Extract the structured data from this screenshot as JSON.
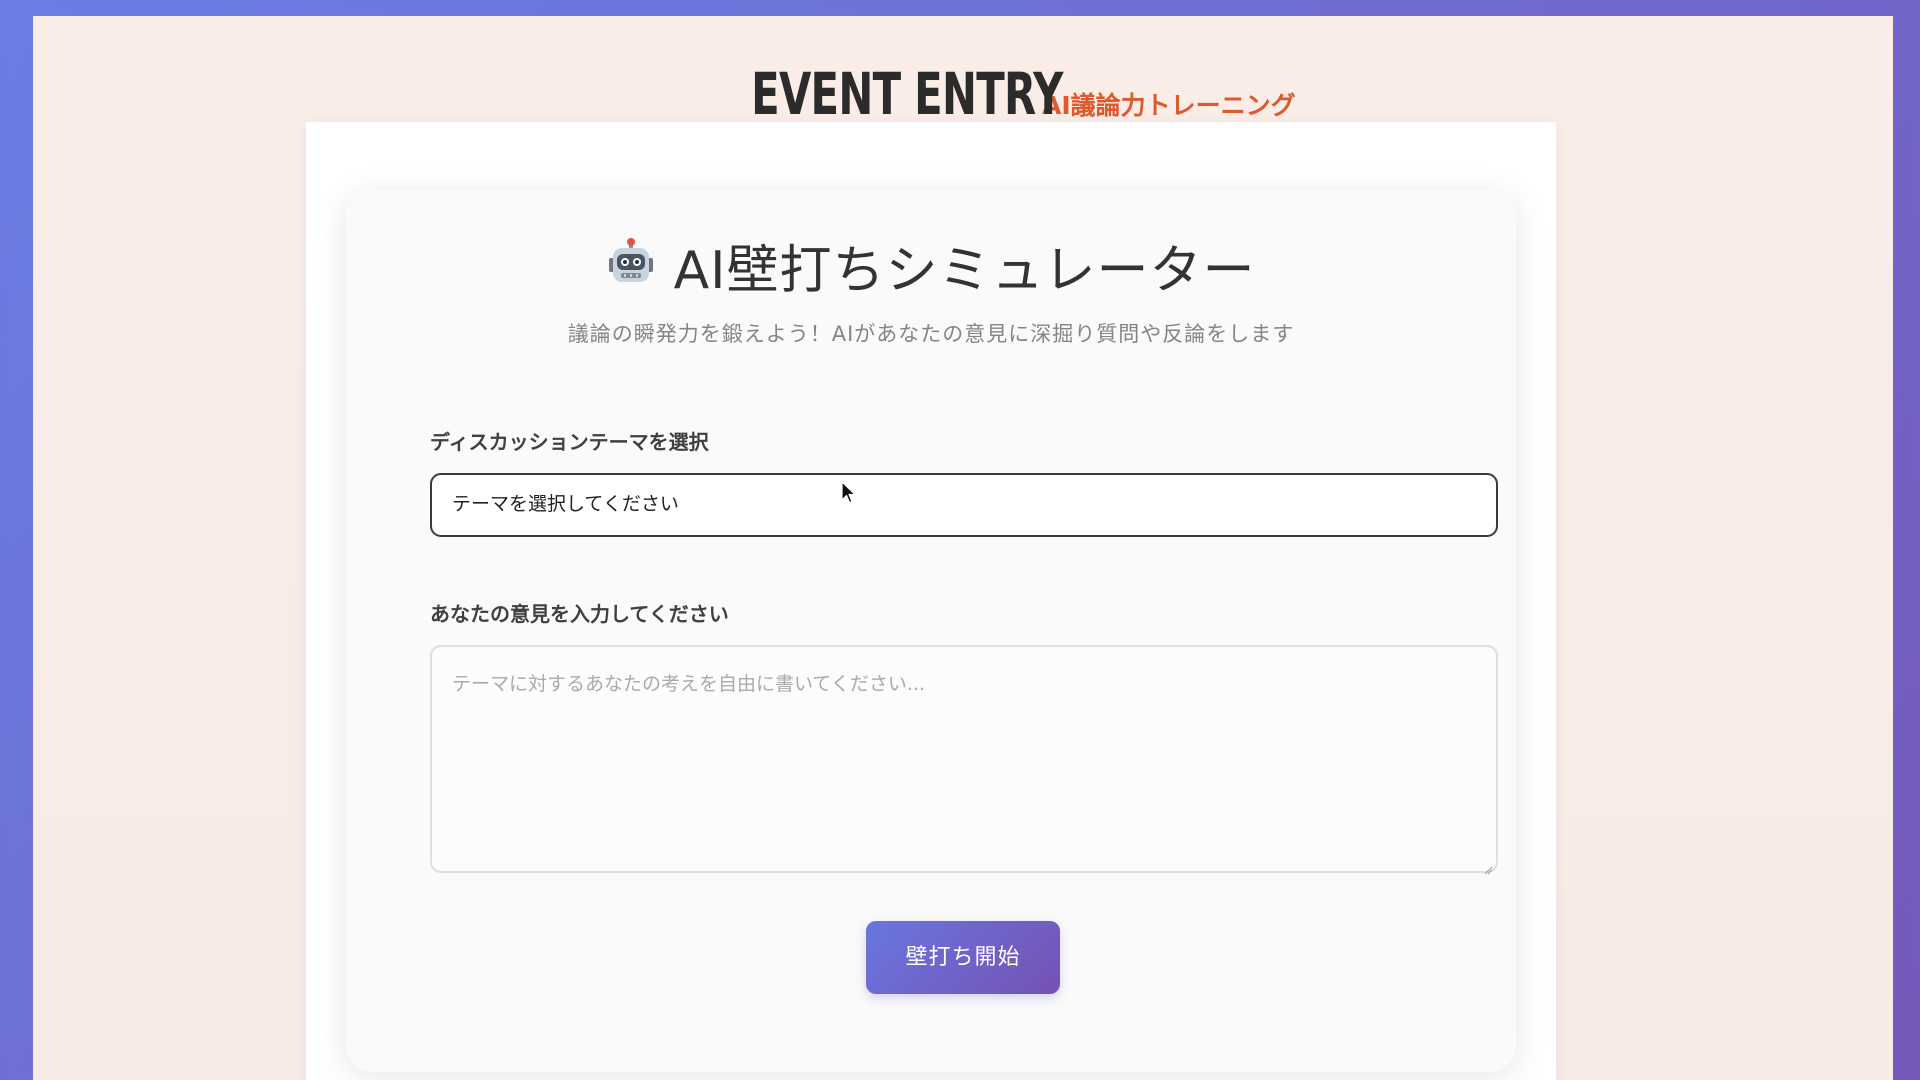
{
  "header": {
    "brand_title": "EVENT ENTRY",
    "brand_subtitle": "AI議論力トレーニング"
  },
  "simulator": {
    "title_icon": "robot-icon",
    "title": "AI壁打ちシミュレーター",
    "subtitle": "議論の瞬発力を鍛えよう！AIがあなたの意見に深掘り質問や反論をします",
    "theme_label": "ディスカッションテーマを選択",
    "theme_select_value": "テーマを選択してください",
    "opinion_label": "あなたの意見を入力してください",
    "opinion_placeholder": "テーマに対するあなたの考えを自由に書いてください...",
    "start_button": "壁打ち開始"
  },
  "colors": {
    "frame_gradient_start": "#6a7ee6",
    "frame_gradient_end": "#7558b8",
    "page_background": "#faede8",
    "brand_subtitle": "#de5a2e",
    "button_gradient_start": "#6877e0",
    "button_gradient_end": "#7651b2"
  }
}
